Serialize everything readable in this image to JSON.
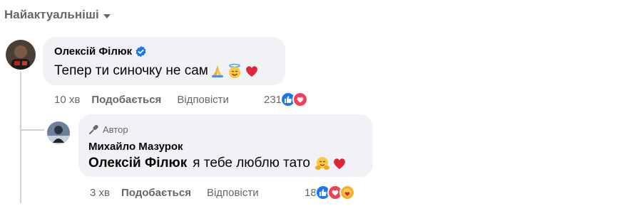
{
  "sort": {
    "label": "Найактуальніші",
    "icon": "caret-down-icon"
  },
  "comments": [
    {
      "author": "Олексій Філюк",
      "verified": true,
      "text": "Тепер ти синочку не сам",
      "emojis": [
        "folded-hands",
        "smiling-face-with-halo",
        "red-heart"
      ],
      "time": "10 хв",
      "like_label": "Подобається",
      "reply_label": "Відповісти",
      "reaction_count": "231",
      "reactions": [
        "like",
        "love"
      ]
    },
    {
      "author_badge": "Автор",
      "author": "Михайло Мазурок",
      "mention": "Олексій Філюк",
      "text": "я тебе люблю тато",
      "emojis": [
        "face-with-hugging-hands",
        "red-heart"
      ],
      "time": "3 хв",
      "like_label": "Подобається",
      "reply_label": "Відповісти",
      "reaction_count": "18",
      "reactions": [
        "like",
        "love",
        "care"
      ]
    }
  ],
  "colors": {
    "like": "#1877f2",
    "love": "#f33e58",
    "care": "#f7b125",
    "bubble": "#f0f2f5",
    "meta": "#65676b"
  }
}
